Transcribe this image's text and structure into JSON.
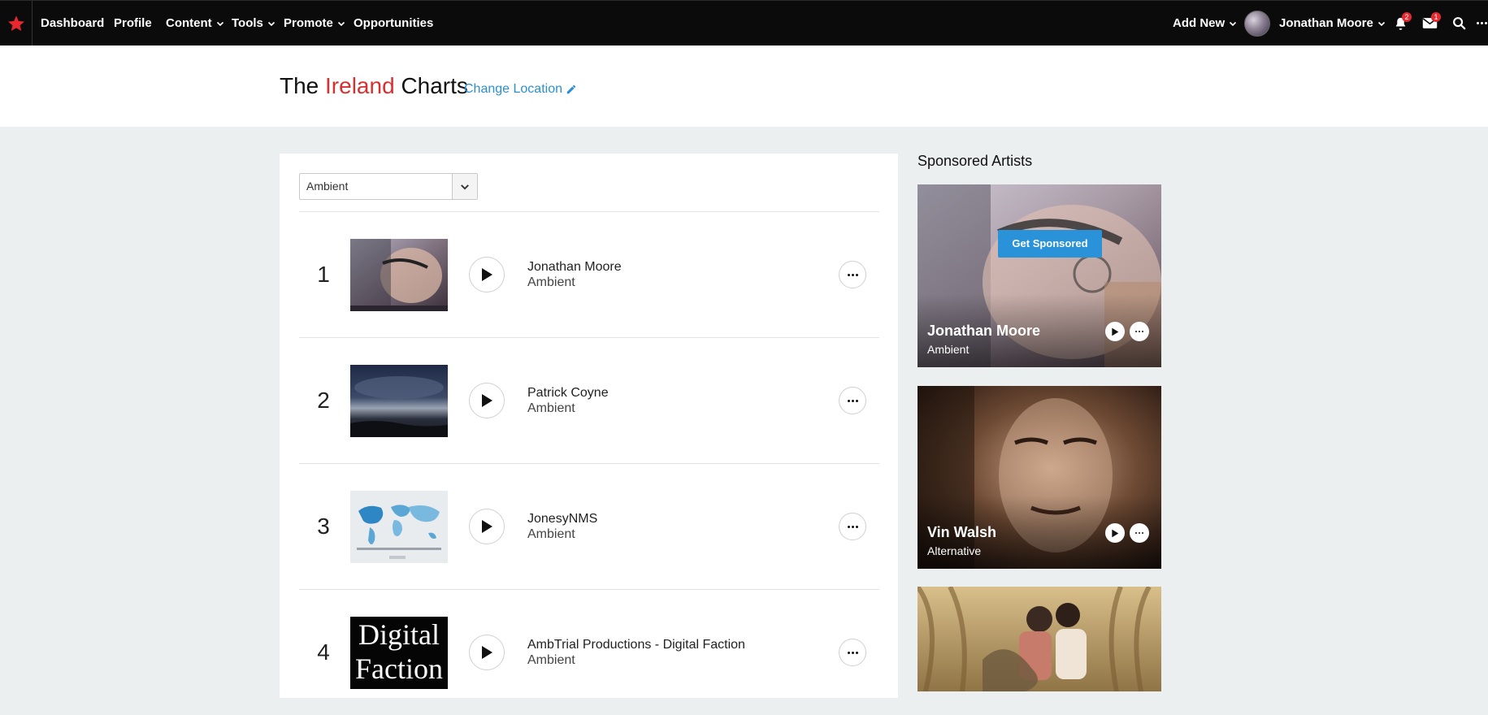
{
  "nav": {
    "items": [
      {
        "label": "Dashboard"
      },
      {
        "label": "Profile"
      },
      {
        "label": "Content"
      },
      {
        "label": "Tools"
      },
      {
        "label": "Promote"
      },
      {
        "label": "Opportunities"
      }
    ],
    "add_new": "Add New",
    "user_name": "Jonathan Moore",
    "notifications_count": "2",
    "messages_count": "1",
    "brand_color": "#e8282e"
  },
  "header": {
    "title_prefix": "The",
    "title_location": "Ireland",
    "title_suffix": "Charts",
    "change_location": "Change Location"
  },
  "filter": {
    "genre_selected": "Ambient"
  },
  "chart": {
    "rows": [
      {
        "rank": "1",
        "name": "Jonathan Moore",
        "genre": "Ambient"
      },
      {
        "rank": "2",
        "name": "Patrick Coyne",
        "genre": "Ambient"
      },
      {
        "rank": "3",
        "name": "JonesyNMS",
        "genre": "Ambient"
      },
      {
        "rank": "4",
        "name": "AmbTrial Productions - Digital Faction",
        "genre": "Ambient",
        "thumb_text_line1": "Digital",
        "thumb_text_line2": "Faction"
      }
    ]
  },
  "sponsored": {
    "heading": "Sponsored Artists",
    "get_sponsored": "Get Sponsored",
    "cards": [
      {
        "name": "Jonathan Moore",
        "genre": "Ambient"
      },
      {
        "name": "Vin Walsh",
        "genre": "Alternative"
      }
    ]
  }
}
